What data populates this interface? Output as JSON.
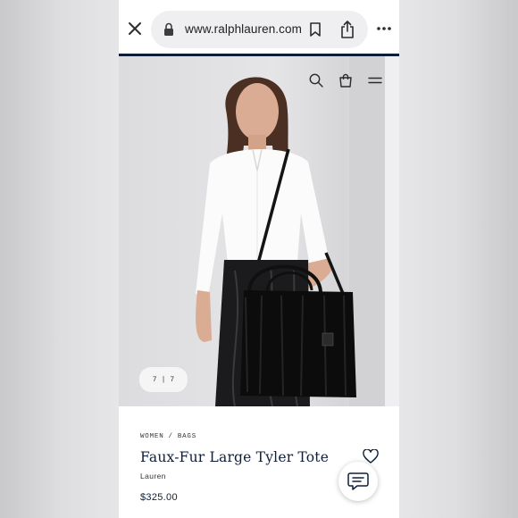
{
  "browser": {
    "url": "www.ralphlauren.com",
    "icons": [
      "close-icon",
      "lock-icon",
      "bookmark-icon",
      "share-icon",
      "more-icon"
    ]
  },
  "site_header": {
    "icons": [
      "search-icon",
      "shopping-bag-icon",
      "menu-icon"
    ]
  },
  "gallery": {
    "current": "7",
    "separator": "|",
    "total": "7"
  },
  "product": {
    "breadcrumb": [
      "WOMEN",
      "BAGS"
    ],
    "breadcrumb_separator": "/",
    "title": "Faux-Fur Large Tyler Tote",
    "brand": "Lauren",
    "price": "$325.00"
  },
  "colors": {
    "navy": "#0f1e38",
    "page_background": "#e6e6e8",
    "hero_background": "#e0e0e2"
  }
}
